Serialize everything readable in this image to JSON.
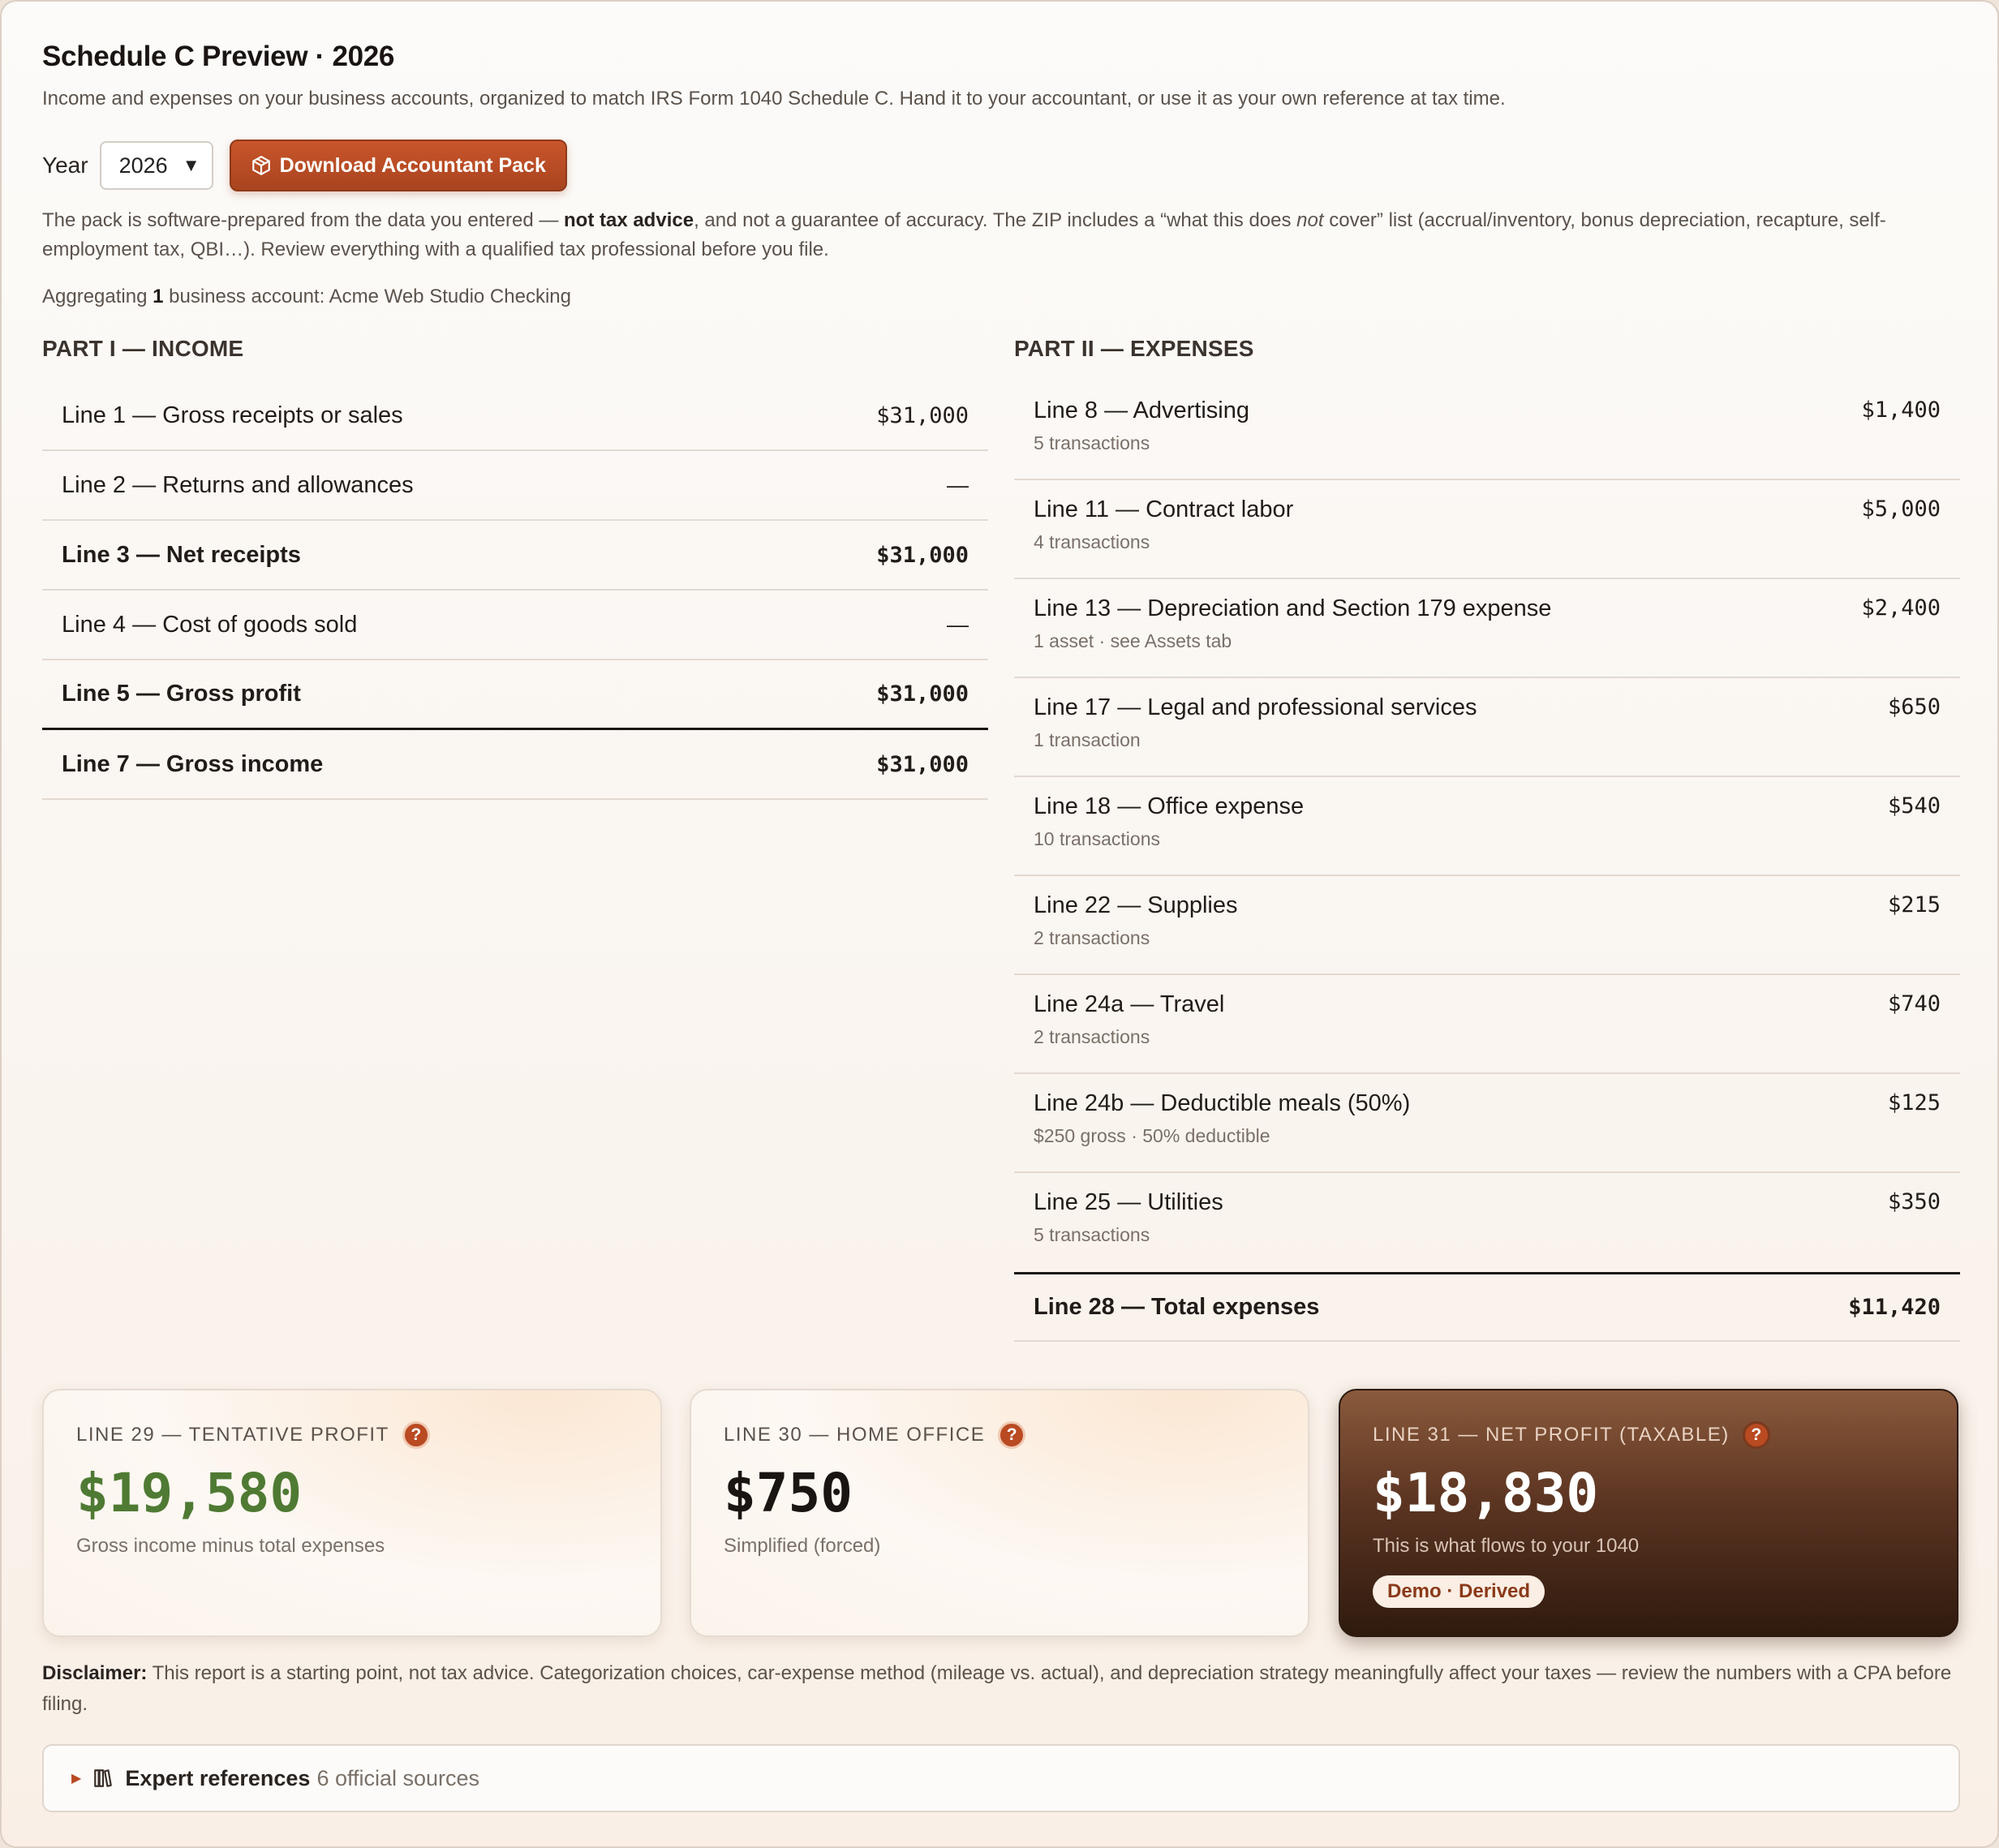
{
  "header": {
    "title": "Schedule C Preview · 2026",
    "subtitle": "Income and expenses on your business accounts, organized to match IRS Form 1040 Schedule C. Hand it to your accountant, or use it as your own reference at tax time."
  },
  "controls": {
    "year_label": "Year",
    "year_value": "2026",
    "download_label": "Download Accountant Pack"
  },
  "notice": {
    "part1": "The pack is software-prepared from the data you entered — ",
    "bold": "not tax advice",
    "part2": ", and not a guarantee of accuracy. The ZIP includes a “what this does ",
    "italic": "not",
    "part3": " cover” list (accrual/inventory, bonus depreciation, recapture, self-employment tax, QBI…). Review everything with a qualified tax professional before you file."
  },
  "aggregating": {
    "prefix": "Aggregating ",
    "count": "1",
    "suffix": " business account: Acme Web Studio Checking"
  },
  "income": {
    "heading": "PART I — INCOME",
    "lines": [
      {
        "label": "Line 1 — Gross receipts or sales",
        "amount": "$31,000"
      },
      {
        "label": "Line 2 — Returns and allowances",
        "amount": "—"
      },
      {
        "label": "Line 3 — Net receipts",
        "amount": "$31,000"
      },
      {
        "label": "Line 4 — Cost of goods sold",
        "amount": "—"
      },
      {
        "label": "Line 5 — Gross profit",
        "amount": "$31,000"
      },
      {
        "label": "Line 7 — Gross income",
        "amount": "$31,000"
      }
    ]
  },
  "expenses": {
    "heading": "PART II — EXPENSES",
    "lines": [
      {
        "label": "Line 8 — Advertising",
        "sub": "5 transactions",
        "amount": "$1,400"
      },
      {
        "label": "Line 11 — Contract labor",
        "sub": "4 transactions",
        "amount": "$5,000"
      },
      {
        "label": "Line 13 — Depreciation and Section 179 expense",
        "sub": "1 asset · see Assets tab",
        "amount": "$2,400"
      },
      {
        "label": "Line 17 — Legal and professional services",
        "sub": "1 transaction",
        "amount": "$650"
      },
      {
        "label": "Line 18 — Office expense",
        "sub": "10 transactions",
        "amount": "$540"
      },
      {
        "label": "Line 22 — Supplies",
        "sub": "2 transactions",
        "amount": "$215"
      },
      {
        "label": "Line 24a — Travel",
        "sub": "2 transactions",
        "amount": "$740"
      },
      {
        "label": "Line 24b — Deductible meals (50%)",
        "sub": "$250 gross · 50% deductible",
        "amount": "$125"
      },
      {
        "label": "Line 25 — Utilities",
        "sub": "5 transactions",
        "amount": "$350"
      }
    ],
    "total": {
      "label": "Line 28 — Total expenses",
      "amount": "$11,420"
    }
  },
  "cards": [
    {
      "title": "LINE 29 — TENTATIVE PROFIT",
      "value": "$19,580",
      "desc": "Gross income minus total expenses"
    },
    {
      "title": "LINE 30 — HOME OFFICE",
      "value": "$750",
      "desc": "Simplified (forced)"
    },
    {
      "title": "LINE 31 — NET PROFIT (TAXABLE)",
      "value": "$18,830",
      "desc": "This is what flows to your 1040",
      "badge": "Demo · Derived"
    }
  ],
  "help_glyph": "?",
  "disclaimer": {
    "label": "Disclaimer:",
    "text": " This report is a starting point, not tax advice. Categorization choices, car-expense method (mileage vs. actual), and depreciation strategy meaningfully affect your taxes — review the numbers with a CPA before filing."
  },
  "references": {
    "title": "Expert references",
    "count": "6 official sources"
  },
  "icons": {
    "download": "package-icon",
    "references": "books-icon",
    "select": "chevron-down-icon",
    "help": "help-icon"
  },
  "colors": {
    "accent": "#b94a22",
    "profit_green": "#4f7a33",
    "dark_card": "#3a2012"
  }
}
